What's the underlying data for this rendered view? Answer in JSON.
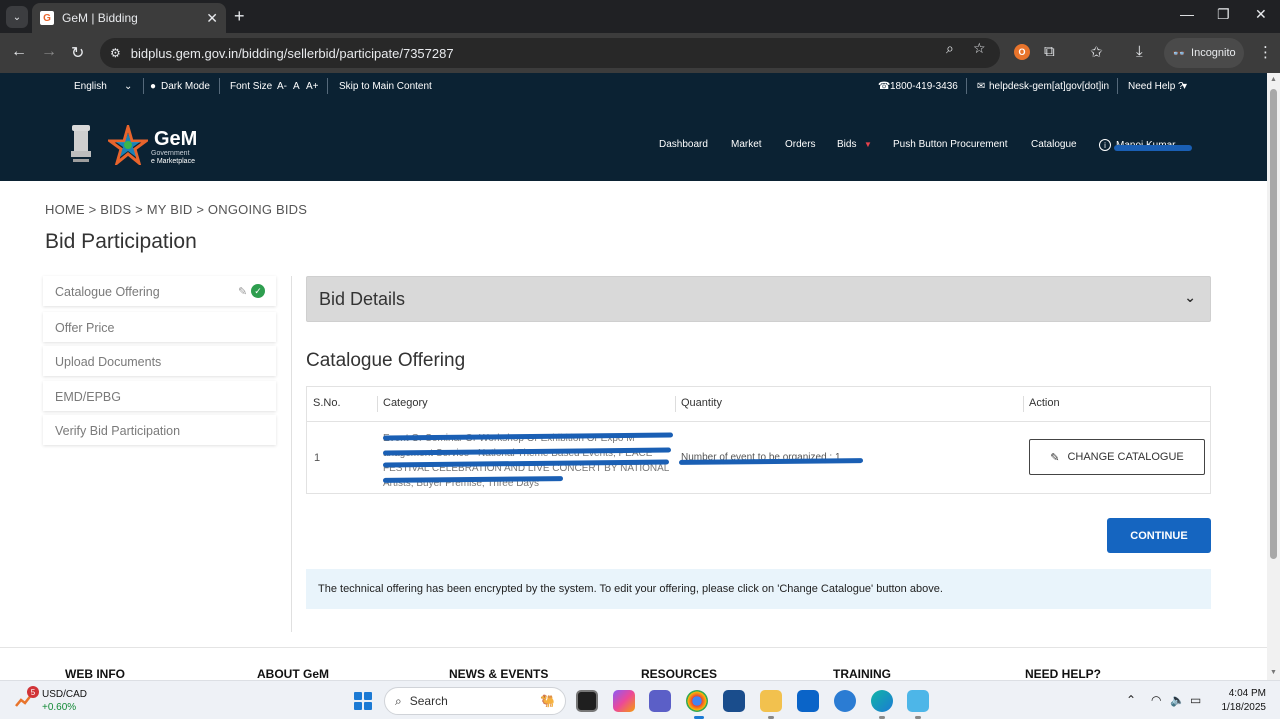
{
  "browser": {
    "tab_title": "GeM | Bidding",
    "url": "bidplus.gem.gov.in/bidding/sellerbid/participate/7357287",
    "incognito_label": "Incognito"
  },
  "utility_bar": {
    "language": "English",
    "dark_mode": "Dark Mode",
    "font_size_label": "Font Size",
    "font_small": "A-",
    "font_normal": "A",
    "font_large": "A+",
    "skip_link": "Skip to Main Content",
    "phone": "1800-419-3436",
    "email": "helpdesk-gem[at]gov[dot]in",
    "need_help": "Need Help ?"
  },
  "logo": {
    "name": "GeM",
    "sub1": "Government",
    "sub2": "e Marketplace"
  },
  "nav": {
    "dashboard": "Dashboard",
    "market": "Market",
    "orders": "Orders",
    "bids": "Bids",
    "push_button": "Push Button Procurement",
    "catalogue": "Catalogue",
    "user": "Manoj Kumar"
  },
  "page": {
    "breadcrumb": "HOME > BIDS > MY BID > ONGOING BIDS",
    "title": "Bid Participation"
  },
  "sidebar": {
    "items": [
      {
        "label": "Catalogue Offering"
      },
      {
        "label": "Offer Price"
      },
      {
        "label": "Upload Documents"
      },
      {
        "label": "EMD/EPBG"
      },
      {
        "label": "Verify Bid Participation"
      }
    ]
  },
  "bid_details": {
    "title": "Bid Details"
  },
  "catalogue": {
    "title": "Catalogue Offering",
    "columns": {
      "sno": "S.No.",
      "category": "Category",
      "quantity": "Quantity",
      "action": "Action"
    },
    "row": {
      "sno": "1",
      "category_lines": [
        "Event Or Seminar Or Workshop Or Exhibition Or Expo M",
        "anagement Service - National Theme Based Events; PEACE",
        "FESTIVAL CELEBRATION AND LIVE CONCERT BY NATIONAL",
        "Artists; Buyer Premise; Three Days"
      ],
      "quantity": "Number of event to be organized : 1",
      "action_label": "CHANGE CATALOGUE"
    }
  },
  "continue_label": "CONTINUE",
  "info_text": "The technical offering has been encrypted by the system. To edit your offering, please click on 'Change Catalogue' button above.",
  "footer": {
    "headings": [
      "WEB INFO",
      "ABOUT GeM",
      "NEWS & EVENTS",
      "RESOURCES",
      "TRAINING",
      "NEED HELP?"
    ]
  },
  "taskbar": {
    "widget_badge": "5",
    "widget_title": "USD/CAD",
    "widget_change": "+0.60%",
    "search_label": "Search",
    "time": "4:04 PM",
    "date": "1/18/2025"
  }
}
